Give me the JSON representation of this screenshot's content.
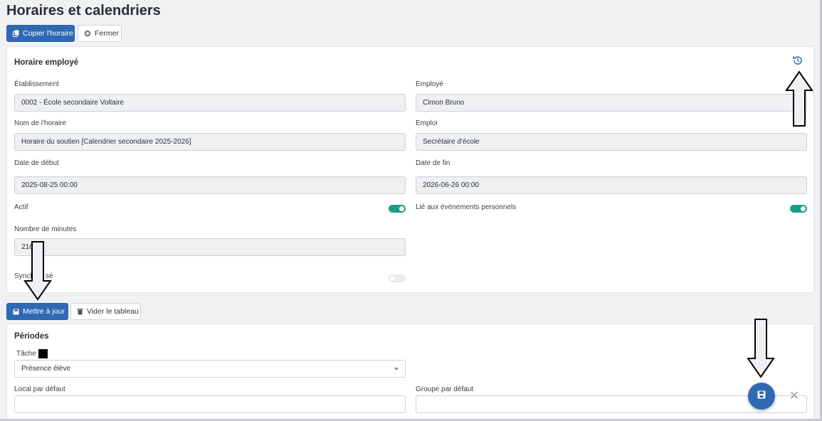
{
  "page": {
    "title": "Horaires et calendriers"
  },
  "toolbar": {
    "copy_label": "Copier l'horaire",
    "close_label": "Fermer"
  },
  "employee_schedule": {
    "title": "Horaire employé",
    "etablissement": {
      "label": "Établissement",
      "value": "0002 - École secondaire Voltaire"
    },
    "employe": {
      "label": "Employé",
      "value": "Cimon Bruno"
    },
    "nom_horaire": {
      "label": "Nom de l'horaire",
      "value": "Horaire du soutien [Calendrier secondaire 2025-2026]"
    },
    "emploi": {
      "label": "Emploi",
      "value": "Secrétaire d'école"
    },
    "date_debut": {
      "label": "Date de début",
      "value": "2025-08-25 00:00"
    },
    "date_fin": {
      "label": "Date de fin",
      "value": "2026-06-26 00:00"
    },
    "actif": {
      "label": "Actif",
      "on": true
    },
    "lie_evenements": {
      "label": "Lié aux évènements personnels",
      "on": true
    },
    "nombre_minutes": {
      "label": "Nombre de minutes",
      "value": "216"
    },
    "synchronise": {
      "label_left": "Synch",
      "label_right": "sé",
      "on": false
    }
  },
  "actions": {
    "update_label": "Mettre à jour",
    "clear_label": "Vider le tableau"
  },
  "periodes": {
    "title": "Périodes",
    "tache": {
      "label": "Tâche",
      "value": "Présence élève"
    },
    "local": {
      "label": "Local par défaut",
      "value": ""
    },
    "groupe": {
      "label": "Groupe par défaut",
      "value": ""
    }
  },
  "fab": {
    "close_symbol": "✕"
  },
  "colors": {
    "primary": "#2f69b3",
    "toggle_on": "#16a085"
  },
  "icons": [
    "copy-icon",
    "close-circle-icon",
    "history-icon",
    "save-icon",
    "trash-icon",
    "chevron-down-icon",
    "arrow-up-icon",
    "arrow-down-icon"
  ]
}
